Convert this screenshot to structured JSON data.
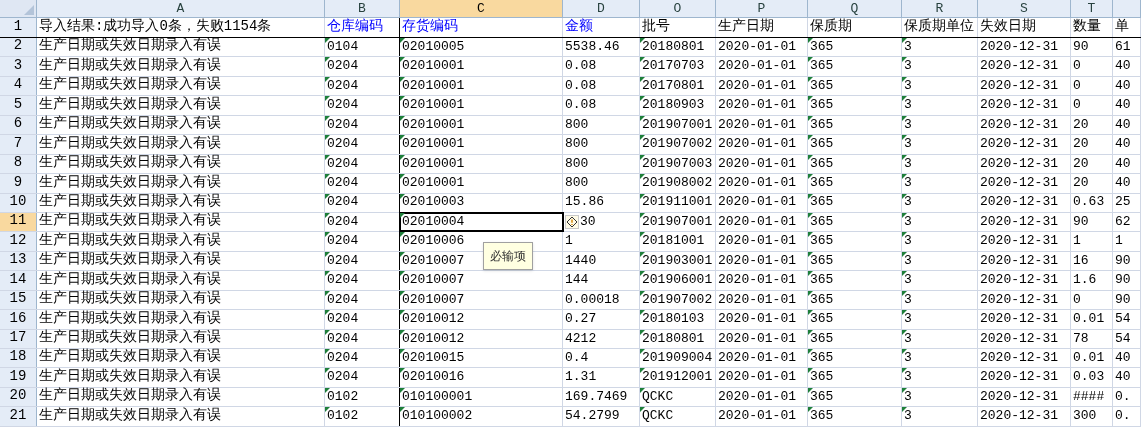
{
  "columns": [
    {
      "letter": "A",
      "title": "导入结果:成功导入0条，失败1154条",
      "required": false,
      "flagged": false,
      "selected": false
    },
    {
      "letter": "B",
      "title": "仓库编码",
      "required": true,
      "flagged": true,
      "selected": false
    },
    {
      "letter": "C",
      "title": "存货编码",
      "required": true,
      "flagged": true,
      "selected": true
    },
    {
      "letter": "D",
      "title": "金额",
      "required": true,
      "flagged": false,
      "selected": false
    },
    {
      "letter": "O",
      "title": "批号",
      "required": false,
      "flagged": true,
      "selected": false
    },
    {
      "letter": "P",
      "title": "生产日期",
      "required": false,
      "flagged": false,
      "selected": false
    },
    {
      "letter": "Q",
      "title": "保质期",
      "required": false,
      "flagged": true,
      "selected": false
    },
    {
      "letter": "R",
      "title": "保质期单位",
      "required": false,
      "flagged": true,
      "selected": false
    },
    {
      "letter": "S",
      "title": "失效日期",
      "required": false,
      "flagged": false,
      "selected": false
    },
    {
      "letter": "T",
      "title": "数量",
      "required": false,
      "flagged": false,
      "selected": false
    },
    {
      "title": "单",
      "required": false,
      "flagged": false,
      "selected": false
    }
  ],
  "title_row": {
    "number": "1"
  },
  "rows": [
    {
      "number": "2",
      "selected": false,
      "warning": false,
      "cells": [
        "生产日期或失效日期录入有误",
        "0104",
        "02010005",
        "5538.46",
        "20180801",
        "2020-01-01",
        "365",
        "3",
        "2020-12-31",
        "90",
        "61"
      ]
    },
    {
      "number": "3",
      "selected": false,
      "warning": false,
      "cells": [
        "生产日期或失效日期录入有误",
        "0204",
        "02010001",
        "0.08",
        "20170703",
        "2020-01-01",
        "365",
        "3",
        "2020-12-31",
        "0",
        "40"
      ]
    },
    {
      "number": "4",
      "selected": false,
      "warning": false,
      "cells": [
        "生产日期或失效日期录入有误",
        "0204",
        "02010001",
        "0.08",
        "20170801",
        "2020-01-01",
        "365",
        "3",
        "2020-12-31",
        "0",
        "40"
      ]
    },
    {
      "number": "5",
      "selected": false,
      "warning": false,
      "cells": [
        "生产日期或失效日期录入有误",
        "0204",
        "02010001",
        "0.08",
        "20180903",
        "2020-01-01",
        "365",
        "3",
        "2020-12-31",
        "0",
        "40"
      ]
    },
    {
      "number": "6",
      "selected": false,
      "warning": false,
      "cells": [
        "生产日期或失效日期录入有误",
        "0204",
        "02010001",
        "800",
        "201907001",
        "2020-01-01",
        "365",
        "3",
        "2020-12-31",
        "20",
        "40"
      ]
    },
    {
      "number": "7",
      "selected": false,
      "warning": false,
      "cells": [
        "生产日期或失效日期录入有误",
        "0204",
        "02010001",
        "800",
        "201907002",
        "2020-01-01",
        "365",
        "3",
        "2020-12-31",
        "20",
        "40"
      ]
    },
    {
      "number": "8",
      "selected": false,
      "warning": false,
      "cells": [
        "生产日期或失效日期录入有误",
        "0204",
        "02010001",
        "800",
        "201907003",
        "2020-01-01",
        "365",
        "3",
        "2020-12-31",
        "20",
        "40"
      ]
    },
    {
      "number": "9",
      "selected": false,
      "warning": false,
      "cells": [
        "生产日期或失效日期录入有误",
        "0204",
        "02010001",
        "800",
        "201908002",
        "2020-01-01",
        "365",
        "3",
        "2020-12-31",
        "20",
        "40"
      ]
    },
    {
      "number": "10",
      "selected": false,
      "warning": false,
      "cells": [
        "生产日期或失效日期录入有误",
        "0204",
        "02010003",
        "15.86",
        "201911001",
        "2020-01-01",
        "365",
        "3",
        "2020-12-31",
        "0.63",
        "25"
      ]
    },
    {
      "number": "11",
      "selected": true,
      "warning": true,
      "cells": [
        "生产日期或失效日期录入有误",
        "0204",
        "02010004",
        "30",
        "201907001",
        "2020-01-01",
        "365",
        "3",
        "2020-12-31",
        "90",
        "62"
      ]
    },
    {
      "number": "12",
      "selected": false,
      "warning": false,
      "cells": [
        "生产日期或失效日期录入有误",
        "0204",
        "02010006",
        "1",
        "20181001",
        "2020-01-01",
        "365",
        "3",
        "2020-12-31",
        "1",
        "1"
      ]
    },
    {
      "number": "13",
      "selected": false,
      "warning": false,
      "cells": [
        "生产日期或失效日期录入有误",
        "0204",
        "02010007",
        "1440",
        "201903001",
        "2020-01-01",
        "365",
        "3",
        "2020-12-31",
        "16",
        "90"
      ]
    },
    {
      "number": "14",
      "selected": false,
      "warning": false,
      "cells": [
        "生产日期或失效日期录入有误",
        "0204",
        "02010007",
        "144",
        "201906001",
        "2020-01-01",
        "365",
        "3",
        "2020-12-31",
        "1.6",
        "90"
      ]
    },
    {
      "number": "15",
      "selected": false,
      "warning": false,
      "cells": [
        "生产日期或失效日期录入有误",
        "0204",
        "02010007",
        "0.00018",
        "201907002",
        "2020-01-01",
        "365",
        "3",
        "2020-12-31",
        "0",
        "90"
      ]
    },
    {
      "number": "16",
      "selected": false,
      "warning": false,
      "cells": [
        "生产日期或失效日期录入有误",
        "0204",
        "02010012",
        "0.27",
        "20180103",
        "2020-01-01",
        "365",
        "3",
        "2020-12-31",
        "0.01",
        "54"
      ]
    },
    {
      "number": "17",
      "selected": false,
      "warning": false,
      "cells": [
        "生产日期或失效日期录入有误",
        "0204",
        "02010012",
        "4212",
        "20180801",
        "2020-01-01",
        "365",
        "3",
        "2020-12-31",
        "78",
        "54"
      ]
    },
    {
      "number": "18",
      "selected": false,
      "warning": false,
      "cells": [
        "生产日期或失效日期录入有误",
        "0204",
        "02010015",
        "0.4",
        "201909004",
        "2020-01-01",
        "365",
        "3",
        "2020-12-31",
        "0.01",
        "40"
      ]
    },
    {
      "number": "19",
      "selected": false,
      "warning": false,
      "cells": [
        "生产日期或失效日期录入有误",
        "0204",
        "02010016",
        "1.31",
        "201912001",
        "2020-01-01",
        "365",
        "3",
        "2020-12-31",
        "0.03",
        "40"
      ]
    },
    {
      "number": "20",
      "selected": false,
      "warning": false,
      "cells": [
        "生产日期或失效日期录入有误",
        "0102",
        "010100001",
        "169.7469",
        "QCKC",
        "2020-01-01",
        "365",
        "3",
        "2020-12-31",
        "####",
        "0."
      ]
    },
    {
      "number": "21",
      "selected": false,
      "warning": false,
      "cells": [
        "生产日期或失效日期录入有误",
        "0102",
        "010100002",
        "54.2799",
        "QCKC",
        "2020-01-01",
        "365",
        "3",
        "2020-12-31",
        "300",
        "0."
      ]
    }
  ],
  "input_message": {
    "text": "必输项"
  }
}
